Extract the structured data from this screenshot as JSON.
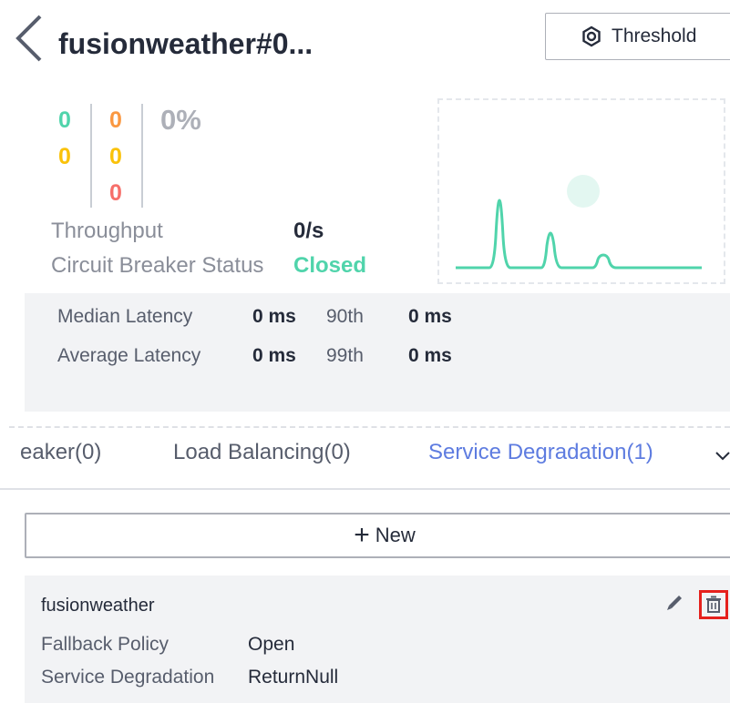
{
  "header": {
    "title": "fusionweather#0...",
    "back_icon": "chevron-left-icon",
    "threshold_label": "Threshold",
    "threshold_icon": "gear-icon"
  },
  "stats": {
    "col1": [
      "0",
      "0"
    ],
    "col2": [
      "0",
      "0",
      "0"
    ],
    "error_percent": "0%",
    "colors": {
      "green": "#50d4ab",
      "yellow": "#fac20a",
      "orange": "#fa9841",
      "red": "#f66f6a"
    }
  },
  "metrics": {
    "throughput_label": "Throughput",
    "throughput_value": "0/s",
    "breaker_label": "Circuit Breaker Status",
    "breaker_value": "Closed"
  },
  "latency": {
    "median_label": "Median Latency",
    "median_value": "0 ms",
    "p90_label": "90th",
    "p90_value": "0 ms",
    "average_label": "Average Latency",
    "average_value": "0 ms",
    "p99_label": "99th",
    "p99_value": "0 ms"
  },
  "tabs": {
    "items": [
      {
        "label": "eaker(0)"
      },
      {
        "label": "Load Balancing(0)"
      },
      {
        "label": "Service Degradation(1)",
        "active": true
      }
    ],
    "more_icon": "chevron-down-icon"
  },
  "new_button": {
    "icon": "+",
    "label": "New"
  },
  "policy_card": {
    "title": "fusionweather",
    "rows": [
      {
        "key": "Fallback Policy",
        "value": "Open"
      },
      {
        "key": "Service Degradation",
        "value": "ReturnNull"
      }
    ],
    "edit_icon": "pencil-icon",
    "delete_icon": "trash-icon"
  },
  "accent_color": "#5e7ce0"
}
